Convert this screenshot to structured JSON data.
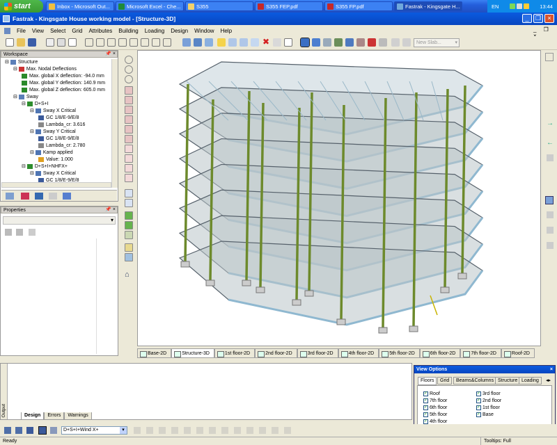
{
  "taskbar": {
    "start_label": "start",
    "tasks": [
      "Inbox - Microsoft Out...",
      "Microsoft Excel - Che...",
      "S355",
      "S355 FEP.pdf",
      "S355 FP.pdf",
      "Fastrak - Kingsgate H..."
    ],
    "language": "EN",
    "clock": "13:44"
  },
  "window": {
    "title": "Fastrak - Kingsgate House working model - [Structure-3D]"
  },
  "menu": [
    "File",
    "View",
    "Select",
    "Grid",
    "Attributes",
    "Building",
    "Loading",
    "Design",
    "Window",
    "Help"
  ],
  "toolbar": {
    "slab_combo": "New Slab..."
  },
  "workspace": {
    "header": "Workspace",
    "tree": [
      {
        "label": "Structure",
        "indent": 0
      },
      {
        "label": "Max. Nodal Deflections",
        "indent": 1
      },
      {
        "label": "Max. global X deflection: -94.0 mm",
        "indent": 2
      },
      {
        "label": "Max. global Y deflection: 140.9 mm",
        "indent": 2
      },
      {
        "label": "Max. global Z deflection: 605.0 mm",
        "indent": 2
      },
      {
        "label": "Sway",
        "indent": 1
      },
      {
        "label": "D+S+I",
        "indent": 2
      },
      {
        "label": "Sway X Critical",
        "indent": 3
      },
      {
        "label": "GC 1/8/E-9/E/8",
        "indent": 4
      },
      {
        "label": "Lambda_cr: 3.616",
        "indent": 4
      },
      {
        "label": "Sway Y Critical",
        "indent": 3
      },
      {
        "label": "GC 1/8/E-9/E/8",
        "indent": 4
      },
      {
        "label": "Lambda_cr: 2.780",
        "indent": 4
      },
      {
        "label": "Kamp applied",
        "indent": 3
      },
      {
        "label": "Value: 1.000",
        "indent": 4
      },
      {
        "label": "D+S+I+NHFX+",
        "indent": 2
      },
      {
        "label": "Sway X Critical",
        "indent": 3
      },
      {
        "label": "GC 1/8/E-9/E/8",
        "indent": 4
      }
    ]
  },
  "properties": {
    "header": "Properties"
  },
  "view_tabs": [
    "Base-2D",
    "Structure-3D",
    "1st floor-2D",
    "2nd floor-2D",
    "3rd floor-2D",
    "4th floor-2D",
    "5th floor-2D",
    "6th floor-2D",
    "7th floor-2D",
    "Roof-2D"
  ],
  "active_view_tab": "Structure-3D",
  "output": {
    "side_label": "Output",
    "tabs": [
      "Design",
      "Errors",
      "Warnings"
    ]
  },
  "view_options": {
    "title": "View Options",
    "tabs": [
      "Floors",
      "Grid",
      "Beams&Columns",
      "Structure",
      "Loading"
    ],
    "col1": [
      "Roof",
      "7th floor",
      "6th floor",
      "5th floor",
      "4th floor"
    ],
    "col2": [
      "3rd floor",
      "2nd floor",
      "1st floor",
      "Base"
    ]
  },
  "bottom_toolbar": {
    "loadcase": "D+S+I+Wind X+"
  },
  "status": {
    "left": "Ready",
    "right": "Tooltips: Full"
  }
}
